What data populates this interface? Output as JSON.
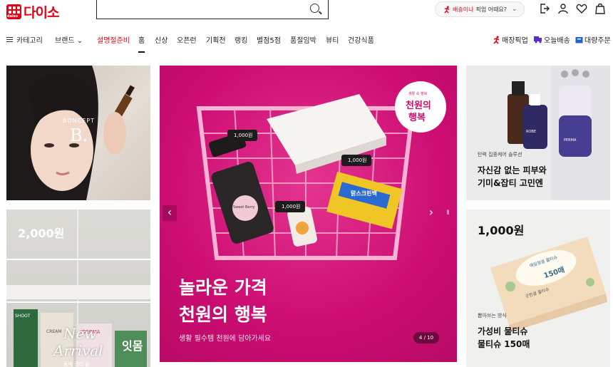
{
  "header": {
    "logo_text": "다이소",
    "logo_small": "daiso",
    "delivery_prefix": "배송이나",
    "delivery_suffix": "픽업 어때요?"
  },
  "nav": {
    "items": [
      {
        "label": "카테고리"
      },
      {
        "label": "브랜드 ⌄"
      },
      {
        "label": "설명절준비",
        "color": "#e60012"
      },
      {
        "label": "홈",
        "active": true
      },
      {
        "label": "신상"
      },
      {
        "label": "오픈런"
      },
      {
        "label": "기획전"
      },
      {
        "label": "랭킹"
      },
      {
        "label": "별점5점"
      },
      {
        "label": "품절임박"
      },
      {
        "label": "뷰티"
      },
      {
        "label": "건강식품"
      }
    ],
    "quick": [
      {
        "label": "매장픽업",
        "icon": "runner-icon",
        "color": "#e60012"
      },
      {
        "label": "오늘배송",
        "icon": "truck-icon",
        "color": "#5b2cd1"
      },
      {
        "label": "대량주문",
        "icon": "box-icon",
        "color": "#1e63d6"
      }
    ]
  },
  "tiles": {
    "boncept_brand": "BONCEPT",
    "boncept_mark": "B.",
    "newarrival_price": "2,000원",
    "newarrival_line1": "New",
    "newarrival_line2": "Arrival",
    "newarrival_pack1": "SHOOT",
    "newarrival_pack2": "CREAM",
    "newarrival_pack3": "IDERMA",
    "newarrival_pack4": "잇몸",
    "newarrival_bottom": "몸매 관리 끝",
    "serum_brand1": "ROBE",
    "serum_brand2": "PERMA",
    "serum_caption": "탄력 집중케어 솔루션",
    "serum_title1": "자신감 없는 피부와",
    "serum_title2": "기미&잡티 고민엔",
    "wipe_price": "1,000원",
    "wipe_pack_title": "매일청결 물티슈",
    "wipe_pack_count": "150매",
    "wipe_pack_sub": "굿한결 물티슈",
    "wipe_caption": "뽑아쓰는 방식",
    "wipe_title1": "가성비 물티슈",
    "wipe_title2": "물티슈 150매"
  },
  "hero": {
    "badge_line1": "생활 속 행복",
    "badge_line2": "천원의",
    "badge_line3": "행복",
    "tag": "1,000원",
    "product_brand": "Sweet Berry",
    "product_pack": "맑스크린백",
    "title1": "놀라운 가격",
    "title2": "천원의 행복",
    "subtitle": "생활 필수템 천원에 담아가세요",
    "pager": "4 / 10",
    "prev": "‹",
    "next": "›",
    "pause": "II"
  }
}
